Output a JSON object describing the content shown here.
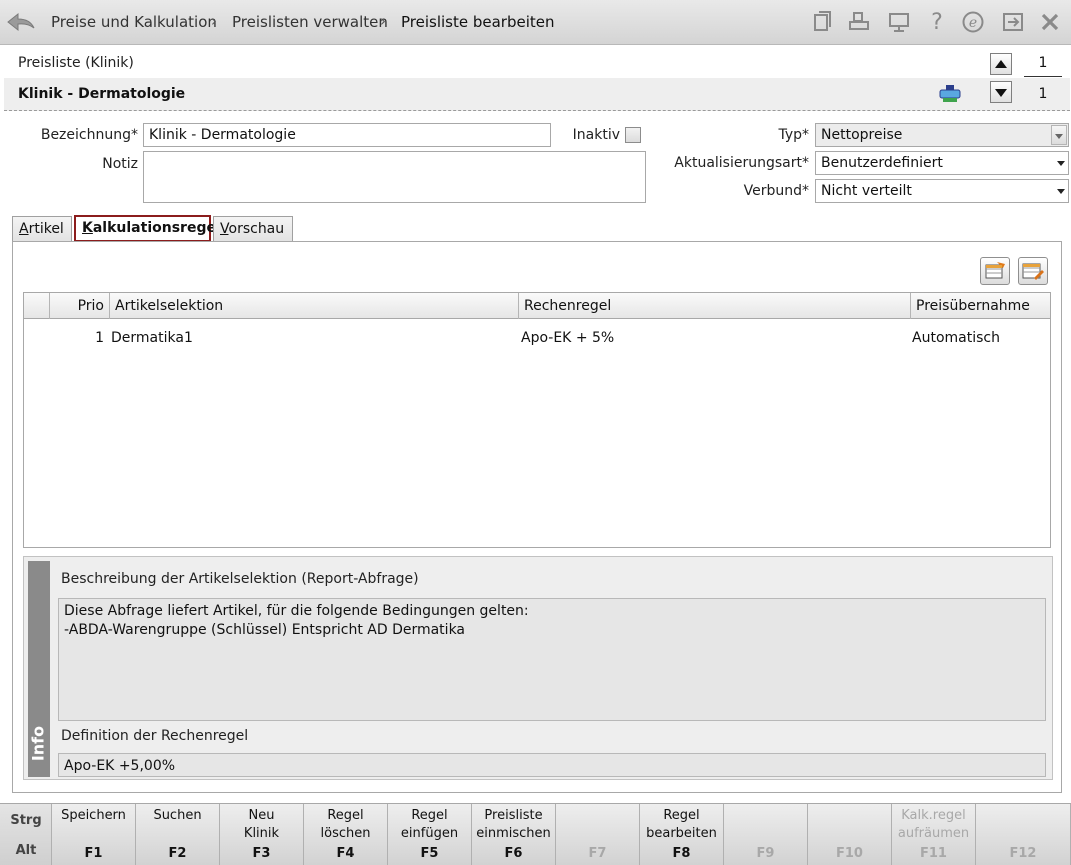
{
  "breadcrumb": [
    "Preise und Kalkulation",
    "Preislisten verwalten",
    "Preisliste bearbeiten"
  ],
  "toolbar_icons": [
    "document-icon",
    "print-icon",
    "monitor-icon",
    "help-icon",
    "e-icon",
    "exit-icon",
    "close-icon"
  ],
  "header": {
    "label": "Preisliste (Klinik)",
    "name": "Klinik - Dermatologie",
    "counter_top": "1",
    "counter_bottom": "1"
  },
  "form": {
    "bezeichnung_label": "Bezeichnung*",
    "bezeichnung_value": "Klinik - Dermatologie",
    "inaktiv_label": "Inaktiv",
    "notiz_label": "Notiz",
    "notiz_value": "",
    "typ_label": "Typ*",
    "typ_value": "Nettopreise",
    "aktualisierung_label": "Aktualisierungsart*",
    "aktualisierung_value": "Benutzerdefiniert",
    "verbund_label": "Verbund*",
    "verbund_value": "Nicht verteilt"
  },
  "tabs": [
    {
      "label": "Artikel",
      "accel": "A",
      "rest": "rtikel"
    },
    {
      "label": "Kalkulationsregel",
      "accel": "K",
      "rest": "alkulationsregel"
    },
    {
      "label": "Vorschau",
      "accel": "V",
      "rest": "orschau"
    }
  ],
  "table": {
    "columns": [
      "Prio",
      "Artikelselektion",
      "Rechenregel",
      "Preisübernahme"
    ],
    "rows": [
      {
        "prio": "1",
        "artikelselektion": "Dermatika1",
        "rechenregel": "Apo-EK + 5%",
        "preisuebernahme": "Automatisch"
      }
    ]
  },
  "info": {
    "strip_label": "Info",
    "beschreibung_label": "Beschreibung der Artikelselektion (Report-Abfrage)",
    "beschreibung_line1": "Diese Abfrage liefert Artikel, für die folgende Bedingungen gelten:",
    "beschreibung_line2": "-ABDA-Warengruppe (Schlüssel) Entspricht AD Dermatika",
    "definition_label": "Definition der Rechenregel",
    "definition_value": "Apo-EK +5,00%"
  },
  "function_bar": {
    "mod_strg": "Strg",
    "mod_alt": "Alt",
    "keys": [
      {
        "line1": "Speichern",
        "line2": "",
        "key": "F1",
        "enabled": true
      },
      {
        "line1": "Suchen",
        "line2": "",
        "key": "F2",
        "enabled": true
      },
      {
        "line1": "Neu",
        "line2": "Klinik",
        "key": "F3",
        "enabled": true
      },
      {
        "line1": "Regel",
        "line2": "löschen",
        "key": "F4",
        "enabled": true
      },
      {
        "line1": "Regel",
        "line2": "einfügen",
        "key": "F5",
        "enabled": true
      },
      {
        "line1": "Preisliste",
        "line2": "einmischen",
        "key": "F6",
        "enabled": true
      },
      {
        "line1": "",
        "line2": "",
        "key": "F7",
        "enabled": false
      },
      {
        "line1": "Regel",
        "line2": "bearbeiten",
        "key": "F8",
        "enabled": true
      },
      {
        "line1": "",
        "line2": "",
        "key": "F9",
        "enabled": false
      },
      {
        "line1": "",
        "line2": "",
        "key": "F10",
        "enabled": false
      },
      {
        "line1": "Kalk.regel",
        "line2": "aufräumen",
        "key": "F11",
        "enabled": false
      },
      {
        "line1": "",
        "line2": "",
        "key": "F12",
        "enabled": false
      }
    ]
  }
}
